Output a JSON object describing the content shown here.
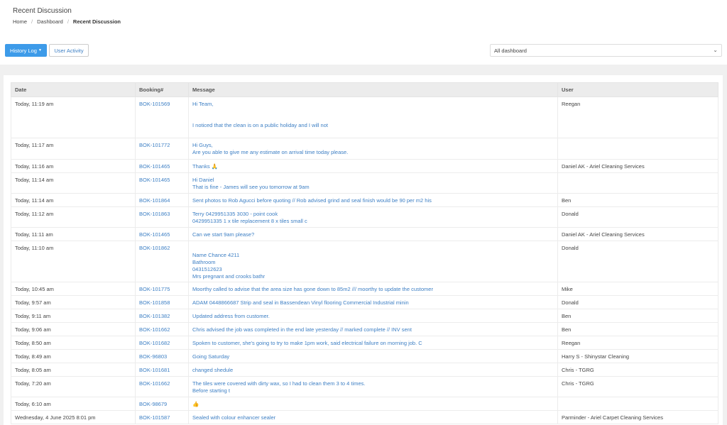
{
  "page": {
    "title": "Recent Discussion",
    "breadcrumb": [
      "Home",
      "Dashboard",
      "Recent Discussion"
    ]
  },
  "toolbar": {
    "history_label": "History Log",
    "activity_label": "User Activity",
    "dashboard_select": "All dashboard"
  },
  "table": {
    "headers": [
      "Date",
      "Booking#",
      "Message",
      "User"
    ],
    "rows": [
      {
        "date": "Today, 11:19 am",
        "booking": "BOK-101569",
        "msg1": "Hi Team,",
        "msg2": "",
        "msg3": "I noticed that the clean is on a public holiday and I will not",
        "msg4": "",
        "user": "Reegan"
      },
      {
        "date": "Today, 11:17 am",
        "booking": "BOK-101772",
        "msg1": "Hi Guys,",
        "msg2": "Are you able to give me any estimate on arrival time today please.",
        "user": ""
      },
      {
        "date": "Today, 11:16 am",
        "booking": "BOK-101465",
        "msg1": "Thanks 🙏",
        "msg2": "",
        "user": "Daniel AK - Ariel Cleaning Services"
      },
      {
        "date": "Today, 11:14 am",
        "booking": "BOK-101465",
        "msg1": "Hi Daniel",
        "msg2": "That is fine - James will see you tomorrow at 9am",
        "user": ""
      },
      {
        "date": "Today, 11:14 am",
        "booking": "BOK-101864",
        "msg1": "Sent photos to Rob Agucci before quoting // Rob advised grind and seal finish would be 90 per m2 his",
        "msg2": "",
        "user": "Ben"
      },
      {
        "date": "Today, 11:12 am",
        "booking": "BOK-101863",
        "msg1": "Terry 0429951335 3030 - point cook",
        "msg2": "0429951335 1 x tile replacement  8 x tiles small c",
        "user": "Donald"
      },
      {
        "date": "Today, 11:11 am",
        "booking": "BOK-101465",
        "msg1": "Can we start 9am please?",
        "msg2": "",
        "user": "Daniel AK - Ariel Cleaning Services"
      },
      {
        "date": "Today, 11:10 am",
        "booking": "BOK-101862",
        "msg1": "Name  Chance  4211",
        "msg2": "Bathroom",
        "msg3": "0431512623",
        "msg4": "Mrs pregnant and crooks bathr",
        "user": "Donald"
      },
      {
        "date": "Today, 10:45 am",
        "booking": "BOK-101775",
        "msg1": "Moorthy called to advise that the area size has gone down to 85m2 /// moorthy to update the customer",
        "msg2": "",
        "user": "Mike"
      },
      {
        "date": "Today, 9:57 am",
        "booking": "BOK-101858",
        "msg1": "ADAM  0448866687 Strip and seal in Bassendean Vinyl flooring  Commercial  Industrial minin",
        "msg2": "",
        "user": "Donald"
      },
      {
        "date": "Today, 9:11 am",
        "booking": "BOK-101382",
        "msg1": "Updated address from customer.",
        "msg2": "",
        "user": "Ben"
      },
      {
        "date": "Today, 9:06 am",
        "booking": "BOK-101662",
        "msg1": "Chris advised the job was completed in the end late yesterday // marked complete // INV sent",
        "msg2": "",
        "user": "Ben"
      },
      {
        "date": "Today, 8:50 am",
        "booking": "BOK-101682",
        "msg1": "Spoken to customer, she's going to try to make 1pm work, said electrical failure on morning job. C",
        "msg2": "",
        "user": "Reegan"
      },
      {
        "date": "Today, 8:49 am",
        "booking": "BOK-96803",
        "msg1": "Going Saturday",
        "msg2": "",
        "user": "Harry S - Shinystar Cleaning"
      },
      {
        "date": "Today, 8:05 am",
        "booking": "BOK-101681",
        "msg1": "changed shedule",
        "msg2": "",
        "user": "Chris - TGRG"
      },
      {
        "date": "Today, 7:20 am",
        "booking": "BOK-101662",
        "msg1": "The tiles were covered with dirty wax, so I had to clean them 3 to 4 times.",
        "msg2": "Before starting t",
        "user": "Chris - TGRG"
      },
      {
        "date": "Today, 6:10 am",
        "booking": "BOK-98679",
        "msg1": "👍",
        "msg2": "",
        "user": ""
      },
      {
        "date": "Wednesday, 4 June 2025 8:01 pm",
        "booking": "BOK-101587",
        "msg1": "Sealed with colour enhancer sealer",
        "msg2": "",
        "user": "Parminder - Ariel Carpet Cleaning Services"
      }
    ]
  }
}
